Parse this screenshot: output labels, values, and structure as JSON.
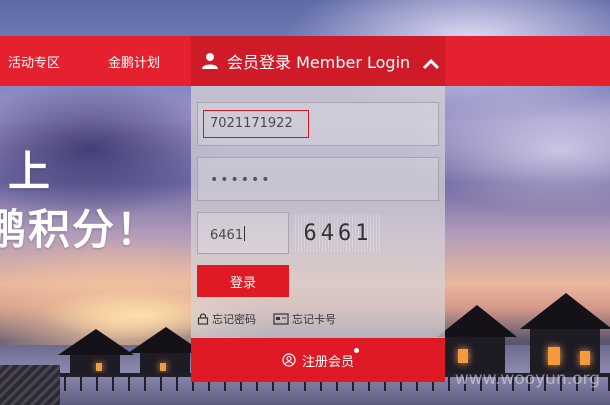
{
  "nav": {
    "items": [
      {
        "label": "活动专区"
      },
      {
        "label": "金鹏计划"
      }
    ]
  },
  "hero": {
    "line1": "上",
    "line2": "鹏积分！"
  },
  "login": {
    "title": "会员登录 Member Login",
    "username_value": "7021171922",
    "password_masked": "••••••",
    "captcha_value": "6461",
    "captcha_image_text": "6461",
    "login_label": "登录",
    "forgot_password_label": "忘记密码",
    "forgot_card_label": "忘记卡号",
    "register_label": "注册会员"
  },
  "watermark": "www.wooyun.org",
  "colors": {
    "brand_red": "#e5202f",
    "button_red": "#df1a24",
    "panel_bg": "rgba(215,210,215,0.72)"
  },
  "icons": {
    "user": "person-icon",
    "collapse": "chevron-up-icon",
    "lock": "lock-icon",
    "card": "card-icon",
    "register": "register-icon"
  }
}
